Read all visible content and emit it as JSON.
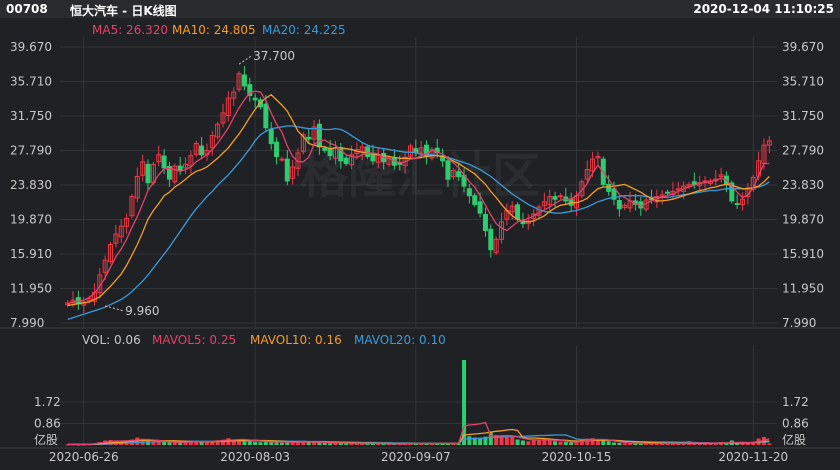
{
  "header": {
    "code": "00708",
    "name": "恒大汽车 - 日K线图",
    "datetime": "2020-12-04 11:10:25"
  },
  "legend_price": [
    {
      "label": "MA5: 26.320",
      "color": "#e0436b"
    },
    {
      "label": "MA10: 24.805",
      "color": "#f39c2a"
    },
    {
      "label": "MA20: 24.225",
      "color": "#3a9ad9"
    }
  ],
  "legend_volume": [
    {
      "label": "VOL: 0.06",
      "color": "#c8c8c8"
    },
    {
      "label": "MAVOL5: 0.25",
      "color": "#e0436b"
    },
    {
      "label": "MAVOL10: 0.16",
      "color": "#f39c2a"
    },
    {
      "label": "MAVOL20: 0.10",
      "color": "#3a9ad9"
    }
  ],
  "colors": {
    "up": "#f23645",
    "down": "#2ecc71",
    "ma5": "#e0436b",
    "ma10": "#f39c2a",
    "ma20": "#3a9ad9",
    "grid": "#333438"
  },
  "watermark": "格隆汇社区",
  "chart_data": {
    "type": "candlestick",
    "price_axis": {
      "ticks": [
        "39.670",
        "35.710",
        "31.750",
        "27.790",
        "23.830",
        "19.870",
        "15.910",
        "11.950",
        "7.990"
      ],
      "ylim": [
        7.99,
        39.67
      ]
    },
    "volume_axis": {
      "ticks": [
        "1.72",
        "0.86",
        "亿股"
      ],
      "ylim": [
        0,
        3.4
      ]
    },
    "x_ticks": [
      "2020-06-26",
      "2020-08-03",
      "2020-09-07",
      "2020-10-15",
      "2020-11-20"
    ],
    "annotations": {
      "high": "37.700",
      "low": "9.960"
    },
    "closes": [
      10.3,
      10.6,
      10.2,
      10.4,
      10.8,
      11.5,
      13.5,
      15.2,
      17.0,
      18.2,
      19.1,
      20.0,
      22.5,
      24.8,
      26.5,
      24.1,
      26.2,
      27.3,
      25.8,
      24.5,
      26.0,
      25.5,
      26.2,
      27.2,
      28.6,
      27.3,
      27.8,
      29.5,
      30.8,
      32.1,
      33.8,
      34.5,
      36.6,
      35.2,
      34.1,
      33.6,
      32.8,
      30.4,
      28.6,
      27.1,
      26.8,
      24.3,
      25.9,
      27.5,
      29.6,
      29.1,
      30.5,
      28.2,
      27.8,
      27.2,
      28.1,
      26.6,
      26.3,
      27.3,
      27.9,
      28.2,
      27.1,
      26.6,
      27.3,
      26.5,
      26.9,
      26.1,
      26.2,
      27.0,
      28.3,
      27.6,
      28.1,
      27.1,
      27.9,
      27.5,
      26.6,
      24.5,
      25.5,
      24.8,
      23.7,
      22.6,
      21.6,
      20.6,
      18.6,
      16.4,
      17.6,
      19.6,
      20.9,
      21.4,
      19.9,
      19.4,
      19.7,
      20.5,
      21.3,
      21.9,
      22.5,
      22.2,
      22.6,
      22.0,
      21.5,
      22.6,
      24.2,
      25.6,
      26.8,
      27.1,
      23.9,
      23.1,
      22.2,
      21.1,
      21.5,
      22.0,
      21.6,
      21.2,
      22.1,
      22.2,
      22.5,
      22.7,
      22.9,
      23.1,
      23.4,
      23.7,
      23.9,
      23.9,
      24.1,
      24.3,
      24.3,
      24.5,
      25.0,
      23.9,
      22.0,
      21.6,
      22.2,
      23.5,
      24.7,
      26.6,
      28.4,
      28.9
    ],
    "ma5": [
      10.2,
      10.4,
      10.5,
      10.6,
      10.9,
      11.4,
      12.2,
      13.2,
      14.4,
      15.6,
      16.5,
      17.6,
      19.0,
      20.2,
      21.7,
      23.2,
      24.1,
      25.0,
      25.7,
      25.7,
      25.6,
      25.4,
      25.6,
      25.9,
      26.5,
      26.9,
      27.3,
      27.9,
      28.6,
      29.5,
      30.4,
      31.6,
      32.7,
      33.6,
      34.4,
      34.6,
      34.5,
      33.5,
      32.1,
      30.8,
      29.9,
      28.3,
      27.1,
      26.5,
      26.5,
      27.0,
      28.5,
      28.9,
      29.0,
      28.6,
      28.4,
      27.8,
      27.3,
      27.1,
      27.0,
      27.3,
      27.5,
      27.5,
      27.4,
      27.0,
      26.9,
      26.6,
      26.4,
      26.5,
      26.8,
      26.9,
      27.2,
      27.4,
      27.8,
      27.6,
      27.4,
      26.9,
      26.4,
      25.8,
      25.0,
      24.2,
      23.6,
      22.6,
      21.5,
      20.4,
      19.4,
      18.9,
      18.6,
      19.1,
      19.6,
      19.8,
      20.0,
      20.3,
      20.6,
      21.0,
      21.3,
      21.7,
      22.1,
      22.2,
      22.2,
      22.6,
      23.2,
      24.0,
      25.2,
      26.1,
      25.3,
      24.5,
      23.6,
      22.7,
      22.4,
      22.0,
      21.7,
      21.4,
      21.7,
      22.0,
      22.2,
      22.5,
      22.6,
      22.8,
      23.1,
      23.4,
      23.6,
      23.8,
      24.0,
      24.1,
      24.2,
      24.4,
      24.6,
      24.4,
      23.7,
      23.0,
      22.4,
      22.7,
      23.5,
      24.9,
      26.3,
      26.3
    ],
    "ma10": [
      10.0,
      10.1,
      10.2,
      10.3,
      10.4,
      10.7,
      11.0,
      11.6,
      12.2,
      12.9,
      13.6,
      14.6,
      15.8,
      17.0,
      18.4,
      19.9,
      20.9,
      21.7,
      22.6,
      23.0,
      23.6,
      24.0,
      24.5,
      25.0,
      25.4,
      25.6,
      25.9,
      26.4,
      26.9,
      27.5,
      28.1,
      28.9,
      29.7,
      30.6,
      31.6,
      32.5,
      33.3,
      33.8,
      34.2,
      33.6,
      33.0,
      32.3,
      31.2,
      30.0,
      29.4,
      28.6,
      28.4,
      28.3,
      28.2,
      28.0,
      28.1,
      28.1,
      28.0,
      27.9,
      27.7,
      27.6,
      27.5,
      27.4,
      27.3,
      27.2,
      27.1,
      27.0,
      26.9,
      26.9,
      26.9,
      26.9,
      27.0,
      27.1,
      27.2,
      27.2,
      27.1,
      26.9,
      26.6,
      26.3,
      25.9,
      25.5,
      25.1,
      24.5,
      23.9,
      23.1,
      22.4,
      21.6,
      20.9,
      20.3,
      19.9,
      19.7,
      19.6,
      19.7,
      20.0,
      20.3,
      20.8,
      21.2,
      21.5,
      21.6,
      21.8,
      21.8,
      22.0,
      22.3,
      22.9,
      23.4,
      23.6,
      23.6,
      23.7,
      23.8,
      23.9,
      23.6,
      23.3,
      23.0,
      22.6,
      22.3,
      22.0,
      22.0,
      22.1,
      22.2,
      22.4,
      22.6,
      22.8,
      23.0,
      23.2,
      23.3,
      23.5,
      23.6,
      23.8,
      23.9,
      23.8,
      23.6,
      23.4,
      23.4,
      23.5,
      23.7,
      24.2,
      24.8
    ],
    "ma20": [
      8.4,
      8.6,
      8.8,
      9.0,
      9.2,
      9.4,
      9.6,
      9.8,
      10.1,
      10.4,
      10.7,
      11.1,
      11.6,
      12.2,
      12.8,
      13.5,
      14.3,
      15.1,
      15.9,
      16.7,
      17.6,
      18.5,
      19.4,
      20.3,
      21.1,
      21.8,
      22.5,
      23.1,
      23.8,
      24.4,
      25.0,
      25.7,
      26.4,
      27.2,
      28.0,
      28.9,
      29.6,
      30.0,
      30.3,
      30.4,
      30.5,
      30.6,
      30.6,
      30.5,
      30.4,
      30.3,
      30.3,
      30.3,
      30.2,
      30.2,
      30.3,
      30.2,
      29.9,
      29.5,
      29.1,
      28.7,
      28.4,
      28.2,
      28.1,
      28.0,
      27.9,
      27.8,
      27.7,
      27.6,
      27.6,
      27.5,
      27.4,
      27.3,
      27.3,
      27.2,
      27.1,
      27.0,
      26.8,
      26.6,
      26.4,
      26.2,
      25.9,
      25.6,
      25.2,
      24.8,
      24.3,
      23.8,
      23.3,
      22.8,
      22.4,
      22.0,
      21.6,
      21.3,
      21.0,
      20.8,
      20.7,
      20.6,
      20.6,
      20.7,
      20.8,
      20.9,
      21.1,
      21.3,
      21.6,
      21.9,
      22.1,
      22.3,
      22.4,
      22.5,
      22.6,
      22.6,
      22.6,
      22.6,
      22.5,
      22.4,
      22.4,
      22.4,
      22.4,
      22.5,
      22.6,
      22.7,
      22.8,
      22.9,
      23.0,
      23.1,
      23.2,
      23.2,
      23.3,
      23.4,
      23.4,
      23.4,
      23.4,
      23.4,
      23.5,
      23.6,
      23.8,
      24.2
    ],
    "volume": [
      0.02,
      0.03,
      0.02,
      0.02,
      0.03,
      0.05,
      0.12,
      0.18,
      0.2,
      0.15,
      0.13,
      0.16,
      0.22,
      0.3,
      0.25,
      0.18,
      0.14,
      0.16,
      0.12,
      0.11,
      0.1,
      0.1,
      0.12,
      0.14,
      0.17,
      0.12,
      0.11,
      0.14,
      0.19,
      0.21,
      0.27,
      0.18,
      0.23,
      0.2,
      0.14,
      0.12,
      0.11,
      0.18,
      0.12,
      0.1,
      0.09,
      0.14,
      0.11,
      0.1,
      0.14,
      0.1,
      0.13,
      0.09,
      0.08,
      0.07,
      0.09,
      0.08,
      0.06,
      0.07,
      0.07,
      0.08,
      0.06,
      0.05,
      0.06,
      0.05,
      0.05,
      0.05,
      0.05,
      0.06,
      0.07,
      0.06,
      0.06,
      0.05,
      0.06,
      0.06,
      0.06,
      0.1,
      0.07,
      0.06,
      3.4,
      0.35,
      0.3,
      0.28,
      0.33,
      0.5,
      0.4,
      0.33,
      0.3,
      0.32,
      0.22,
      0.18,
      0.15,
      0.2,
      0.22,
      0.25,
      0.21,
      0.15,
      0.13,
      0.12,
      0.1,
      0.14,
      0.2,
      0.25,
      0.27,
      0.22,
      0.2,
      0.15,
      0.1,
      0.08,
      0.07,
      0.06,
      0.06,
      0.06,
      0.07,
      0.06,
      0.06,
      0.05,
      0.06,
      0.05,
      0.06,
      0.07,
      0.16,
      0.06,
      0.07,
      0.06,
      0.07,
      0.06,
      0.12,
      0.06,
      0.18,
      0.1,
      0.08,
      0.06,
      0.1,
      0.26,
      0.32,
      0.06
    ],
    "mavol5": [
      0.03,
      0.03,
      0.03,
      0.03,
      0.03,
      0.05,
      0.08,
      0.11,
      0.15,
      0.16,
      0.16,
      0.17,
      0.18,
      0.2,
      0.22,
      0.22,
      0.2,
      0.18,
      0.15,
      0.13,
      0.12,
      0.11,
      0.11,
      0.12,
      0.13,
      0.13,
      0.13,
      0.14,
      0.16,
      0.18,
      0.2,
      0.2,
      0.22,
      0.22,
      0.2,
      0.18,
      0.16,
      0.15,
      0.13,
      0.12,
      0.12,
      0.12,
      0.11,
      0.11,
      0.12,
      0.12,
      0.12,
      0.11,
      0.1,
      0.09,
      0.09,
      0.08,
      0.08,
      0.07,
      0.07,
      0.07,
      0.06,
      0.06,
      0.06,
      0.06,
      0.05,
      0.05,
      0.05,
      0.05,
      0.06,
      0.06,
      0.06,
      0.06,
      0.06,
      0.06,
      0.07,
      0.07,
      0.07,
      0.07,
      0.75,
      0.8,
      0.82,
      0.85,
      0.9,
      0.36,
      0.35,
      0.37,
      0.38,
      0.37,
      0.33,
      0.27,
      0.23,
      0.21,
      0.2,
      0.2,
      0.2,
      0.19,
      0.18,
      0.16,
      0.13,
      0.12,
      0.14,
      0.17,
      0.2,
      0.22,
      0.22,
      0.2,
      0.17,
      0.13,
      0.1,
      0.08,
      0.07,
      0.07,
      0.06,
      0.06,
      0.06,
      0.06,
      0.06,
      0.06,
      0.06,
      0.06,
      0.08,
      0.08,
      0.08,
      0.08,
      0.08,
      0.07,
      0.08,
      0.08,
      0.1,
      0.1,
      0.11,
      0.1,
      0.11,
      0.14,
      0.18,
      0.25
    ],
    "mavol10": [
      0.03,
      0.03,
      0.03,
      0.03,
      0.03,
      0.04,
      0.05,
      0.07,
      0.09,
      0.1,
      0.11,
      0.13,
      0.15,
      0.17,
      0.19,
      0.19,
      0.19,
      0.18,
      0.17,
      0.17,
      0.17,
      0.16,
      0.15,
      0.14,
      0.13,
      0.12,
      0.12,
      0.13,
      0.14,
      0.15,
      0.16,
      0.17,
      0.18,
      0.19,
      0.19,
      0.19,
      0.18,
      0.18,
      0.17,
      0.16,
      0.15,
      0.14,
      0.13,
      0.12,
      0.12,
      0.12,
      0.12,
      0.11,
      0.11,
      0.1,
      0.1,
      0.1,
      0.09,
      0.09,
      0.08,
      0.08,
      0.08,
      0.07,
      0.07,
      0.07,
      0.06,
      0.06,
      0.06,
      0.06,
      0.06,
      0.06,
      0.06,
      0.06,
      0.06,
      0.06,
      0.06,
      0.06,
      0.06,
      0.06,
      0.4,
      0.42,
      0.44,
      0.46,
      0.48,
      0.52,
      0.55,
      0.57,
      0.6,
      0.62,
      0.58,
      0.3,
      0.28,
      0.28,
      0.27,
      0.26,
      0.24,
      0.22,
      0.2,
      0.19,
      0.17,
      0.16,
      0.16,
      0.17,
      0.18,
      0.19,
      0.19,
      0.19,
      0.18,
      0.17,
      0.15,
      0.14,
      0.13,
      0.12,
      0.11,
      0.1,
      0.09,
      0.08,
      0.07,
      0.07,
      0.07,
      0.07,
      0.07,
      0.07,
      0.07,
      0.07,
      0.07,
      0.07,
      0.08,
      0.08,
      0.08,
      0.09,
      0.09,
      0.09,
      0.1,
      0.12,
      0.14,
      0.16
    ],
    "mavol20": [
      0.02,
      0.02,
      0.02,
      0.02,
      0.02,
      0.03,
      0.03,
      0.04,
      0.05,
      0.06,
      0.07,
      0.08,
      0.09,
      0.1,
      0.11,
      0.12,
      0.13,
      0.14,
      0.14,
      0.14,
      0.15,
      0.15,
      0.15,
      0.15,
      0.15,
      0.15,
      0.15,
      0.15,
      0.15,
      0.15,
      0.16,
      0.16,
      0.16,
      0.16,
      0.16,
      0.16,
      0.16,
      0.16,
      0.16,
      0.16,
      0.16,
      0.15,
      0.15,
      0.15,
      0.15,
      0.14,
      0.14,
      0.14,
      0.14,
      0.13,
      0.13,
      0.12,
      0.12,
      0.11,
      0.11,
      0.1,
      0.1,
      0.1,
      0.09,
      0.09,
      0.09,
      0.08,
      0.08,
      0.08,
      0.08,
      0.07,
      0.07,
      0.07,
      0.07,
      0.07,
      0.07,
      0.07,
      0.07,
      0.07,
      0.24,
      0.25,
      0.26,
      0.27,
      0.28,
      0.3,
      0.31,
      0.32,
      0.33,
      0.34,
      0.34,
      0.35,
      0.36,
      0.37,
      0.38,
      0.38,
      0.39,
      0.4,
      0.4,
      0.4,
      0.33,
      0.24,
      0.22,
      0.22,
      0.22,
      0.22,
      0.22,
      0.2,
      0.19,
      0.18,
      0.16,
      0.15,
      0.14,
      0.13,
      0.13,
      0.12,
      0.12,
      0.12,
      0.12,
      0.12,
      0.11,
      0.11,
      0.11,
      0.1,
      0.09,
      0.09,
      0.08,
      0.08,
      0.08,
      0.08,
      0.08,
      0.08,
      0.08,
      0.09,
      0.1,
      0.11,
      0.12,
      0.13
    ]
  }
}
